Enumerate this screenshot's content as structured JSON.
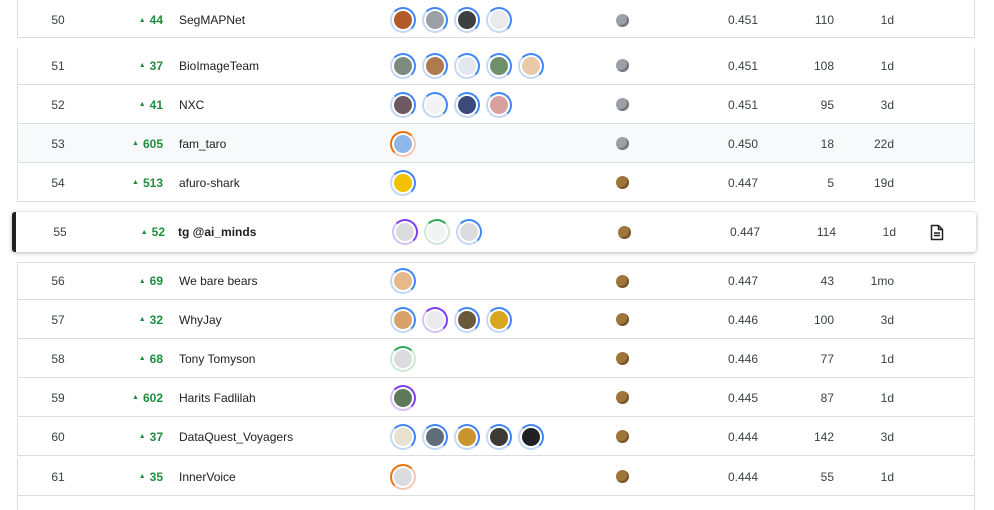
{
  "leaderboard": {
    "rows": [
      {
        "rank": "50",
        "delta": "44",
        "team": "SegMAPNet",
        "medal": "silver",
        "score": "0.451",
        "entries": "110",
        "last": "1d",
        "avatars": [
          {
            "ring": "blue",
            "fill": "#b35a2a"
          },
          {
            "ring": "blue",
            "fill": "#9aa0a6"
          },
          {
            "ring": "blue",
            "fill": "#3c4043"
          },
          {
            "ring": "blue",
            "fill": "#e8eaed"
          }
        ]
      },
      {
        "rank": "51",
        "delta": "37",
        "team": "BioImageTeam",
        "medal": "silver",
        "score": "0.451",
        "entries": "108",
        "last": "1d",
        "avatars": [
          {
            "ring": "blue",
            "fill": "#7c8a80"
          },
          {
            "ring": "blue",
            "fill": "#b07a4f"
          },
          {
            "ring": "blue",
            "fill": "#e3e7ee"
          },
          {
            "ring": "blue",
            "fill": "#6f8f6a"
          },
          {
            "ring": "blue",
            "fill": "#e9c9a8"
          }
        ]
      },
      {
        "rank": "52",
        "delta": "41",
        "team": "NXC",
        "medal": "silver",
        "score": "0.451",
        "entries": "95",
        "last": "3d",
        "avatars": [
          {
            "ring": "blue",
            "fill": "#6d5a60"
          },
          {
            "ring": "blue",
            "fill": "#f1f3f4"
          },
          {
            "ring": "blue",
            "fill": "#3a4a7a"
          },
          {
            "ring": "blue",
            "fill": "#d9a0a0"
          }
        ]
      },
      {
        "rank": "53",
        "delta": "605",
        "team": "fam_taro",
        "medal": "silver",
        "score": "0.450",
        "entries": "18",
        "last": "22d",
        "avatars": [
          {
            "ring": "orange",
            "fill": "#8fb6e8"
          }
        ]
      },
      {
        "rank": "54",
        "delta": "513",
        "team": "afuro-shark",
        "medal": "bronze",
        "score": "0.447",
        "entries": "5",
        "last": "19d",
        "avatars": [
          {
            "ring": "blue",
            "fill": "#f2c200"
          }
        ]
      },
      {
        "rank": "55",
        "delta": "52",
        "team": "tg @ai_minds",
        "medal": "bronze",
        "score": "0.447",
        "entries": "114",
        "last": "1d",
        "avatars": [
          {
            "ring": "purple",
            "fill": "#dadce0"
          },
          {
            "ring": "green",
            "fill": "#f1f3f4"
          },
          {
            "ring": "blue",
            "fill": "#dadce0"
          }
        ]
      },
      {
        "rank": "56",
        "delta": "69",
        "team": "We bare bears",
        "medal": "bronze",
        "score": "0.447",
        "entries": "43",
        "last": "1mo",
        "avatars": [
          {
            "ring": "blue",
            "fill": "#e6b98a"
          }
        ]
      },
      {
        "rank": "57",
        "delta": "32",
        "team": "WhyJay",
        "medal": "bronze",
        "score": "0.446",
        "entries": "100",
        "last": "3d",
        "avatars": [
          {
            "ring": "blue",
            "fill": "#d7a26a"
          },
          {
            "ring": "purple",
            "fill": "#e8eaed"
          },
          {
            "ring": "blue",
            "fill": "#6b5a3a"
          },
          {
            "ring": "blue",
            "fill": "#d9a520"
          }
        ]
      },
      {
        "rank": "58",
        "delta": "68",
        "team": "Tony Tomyson",
        "medal": "bronze",
        "score": "0.446",
        "entries": "77",
        "last": "1d",
        "avatars": [
          {
            "ring": "green",
            "fill": "#dadce0"
          }
        ]
      },
      {
        "rank": "59",
        "delta": "602",
        "team": "Harits Fadlilah",
        "medal": "bronze",
        "score": "0.445",
        "entries": "87",
        "last": "1d",
        "avatars": [
          {
            "ring": "purple",
            "fill": "#5f7a5a"
          }
        ]
      },
      {
        "rank": "60",
        "delta": "37",
        "team": "DataQuest_Voyagers",
        "medal": "bronze",
        "score": "0.444",
        "entries": "142",
        "last": "3d",
        "avatars": [
          {
            "ring": "blue",
            "fill": "#e8e1d0"
          },
          {
            "ring": "blue",
            "fill": "#5f6c7a"
          },
          {
            "ring": "blue",
            "fill": "#c9962e"
          },
          {
            "ring": "blue",
            "fill": "#3c3a35"
          },
          {
            "ring": "blue",
            "fill": "#202124"
          }
        ]
      },
      {
        "rank": "61",
        "delta": "35",
        "team": "InnerVoice",
        "medal": "bronze",
        "score": "0.444",
        "entries": "55",
        "last": "1d",
        "avatars": [
          {
            "ring": "orange",
            "fill": "#dadce0"
          }
        ]
      }
    ]
  },
  "colors": {
    "silver": "#9aa0a6",
    "bronze": "#a0753a",
    "delta_green": "#1e8e3e"
  },
  "icons": {
    "delta": "caret-up-icon",
    "code": "document-icon"
  }
}
